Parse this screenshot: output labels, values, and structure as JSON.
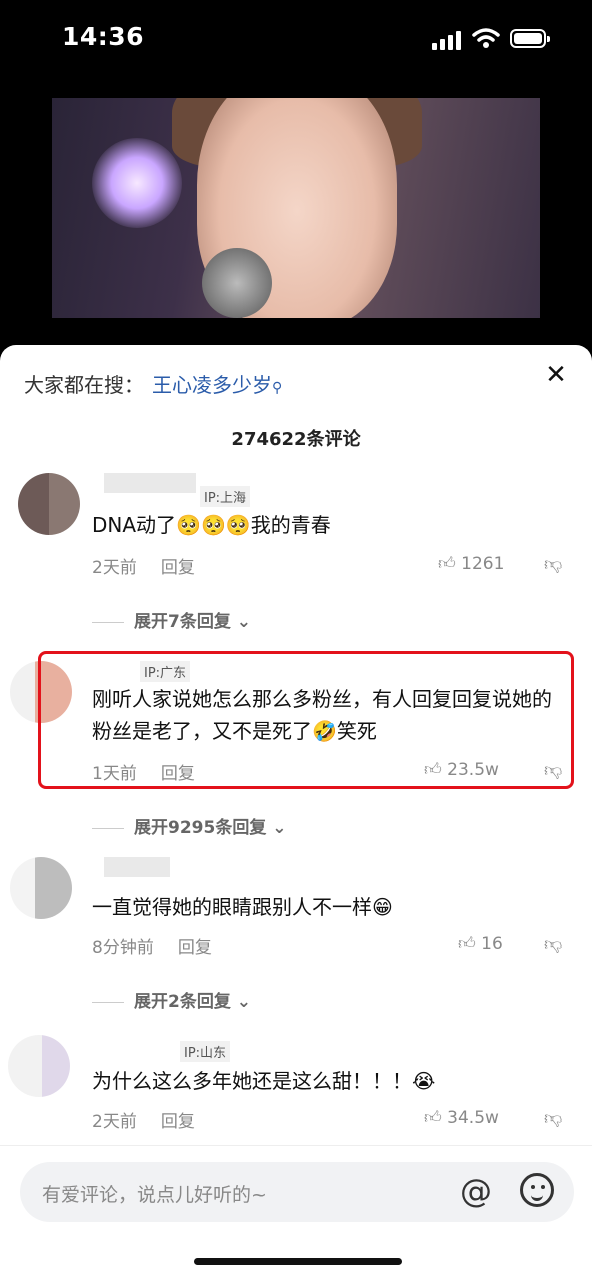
{
  "status": {
    "time": "14:36"
  },
  "search": {
    "label": "大家都在搜：",
    "keyword": "王心凌多少岁"
  },
  "comments_count": "274622条评论",
  "comments": [
    {
      "ip": "IP:上海",
      "text": "DNA动了🥺🥺🥺我的青春",
      "time": "2天前",
      "reply": "回复",
      "likes": "1261",
      "expand": "展开7条回复"
    },
    {
      "ip": "IP:广东",
      "text": "刚听人家说她怎么那么多粉丝，有人回复回复说她的粉丝是老了，又不是死了🤣笑死",
      "time": "1天前",
      "reply": "回复",
      "likes": "23.5w",
      "expand": "展开9295条回复"
    },
    {
      "ip": "",
      "text": "一直觉得她的眼睛跟别人不一样😁",
      "time": "8分钟前",
      "reply": "回复",
      "likes": "16",
      "expand": "展开2条回复"
    },
    {
      "ip": "IP:山东",
      "text": "为什么这么多年她还是这么甜！！！😭",
      "time": "2天前",
      "reply": "回复",
      "likes": "34.5w"
    }
  ],
  "input": {
    "placeholder": "有爱评论，说点儿好听的~"
  },
  "colors": {
    "highlight": "#e3121b",
    "search_keyword": "#2b5caa"
  }
}
